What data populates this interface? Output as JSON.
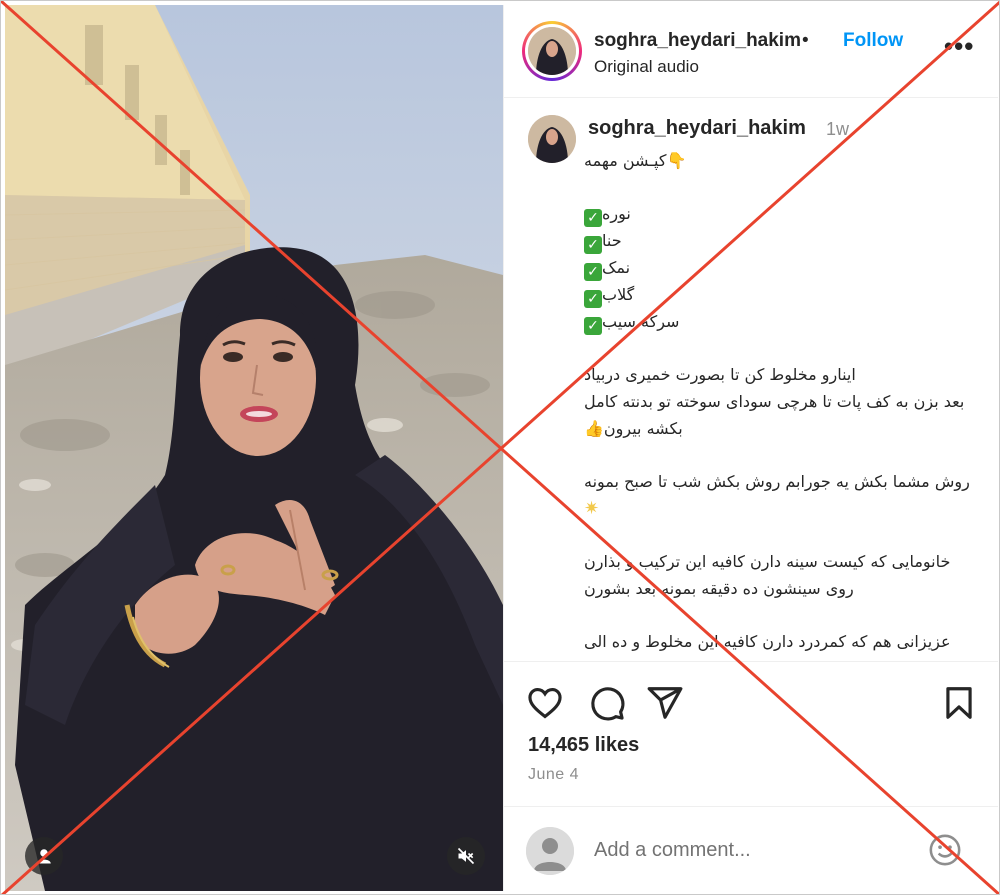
{
  "post": {
    "username": "soghra_heydari_hakim",
    "separator": "•",
    "follow_label": "Follow",
    "audio_label": "Original audio",
    "more_label": "•••",
    "caption_time": "1w",
    "caption_lines": {
      "l1": "👇کپـشن مهمه",
      "l2": "نوره",
      "l3": "حنا",
      "l4": "نمک",
      "l5": "گلاب",
      "l6": "سرکه سیب",
      "l7": "اینارو مخلوط کن تا بصورت خمیری دربیاد",
      "l8": "بعد بزن به کف پات تا هرچی سودای سوخته تو بدنته کامل",
      "l9": "بکشه بیرون",
      "l10": "روش مشما بکش یه جورابم روش بکش شب تا صبح بمونه",
      "l11": "خانومایی که کیست سینه دارن کافیه این ترکیب و بذارن",
      "l12": "روی سینشون ده دقیقه بمونه بعد بشورن",
      "l13": "عزیزانی هم که کمردرد دارن کافیه این مخلوط و ده الی"
    },
    "likes": "14,465 likes",
    "date": "June 4",
    "comment_placeholder": "Add a comment..."
  },
  "icons": {
    "like": "heart-icon",
    "comment": "comment-bubble-icon",
    "share": "paper-plane-icon",
    "save": "bookmark-icon",
    "emoji": "smiley-icon",
    "user_tag": "user-icon",
    "mute": "speaker-muted-icon"
  },
  "colors": {
    "follow": "#0095f6",
    "overlay_x": "#e8432e",
    "muted_text": "#8e8e8e"
  }
}
